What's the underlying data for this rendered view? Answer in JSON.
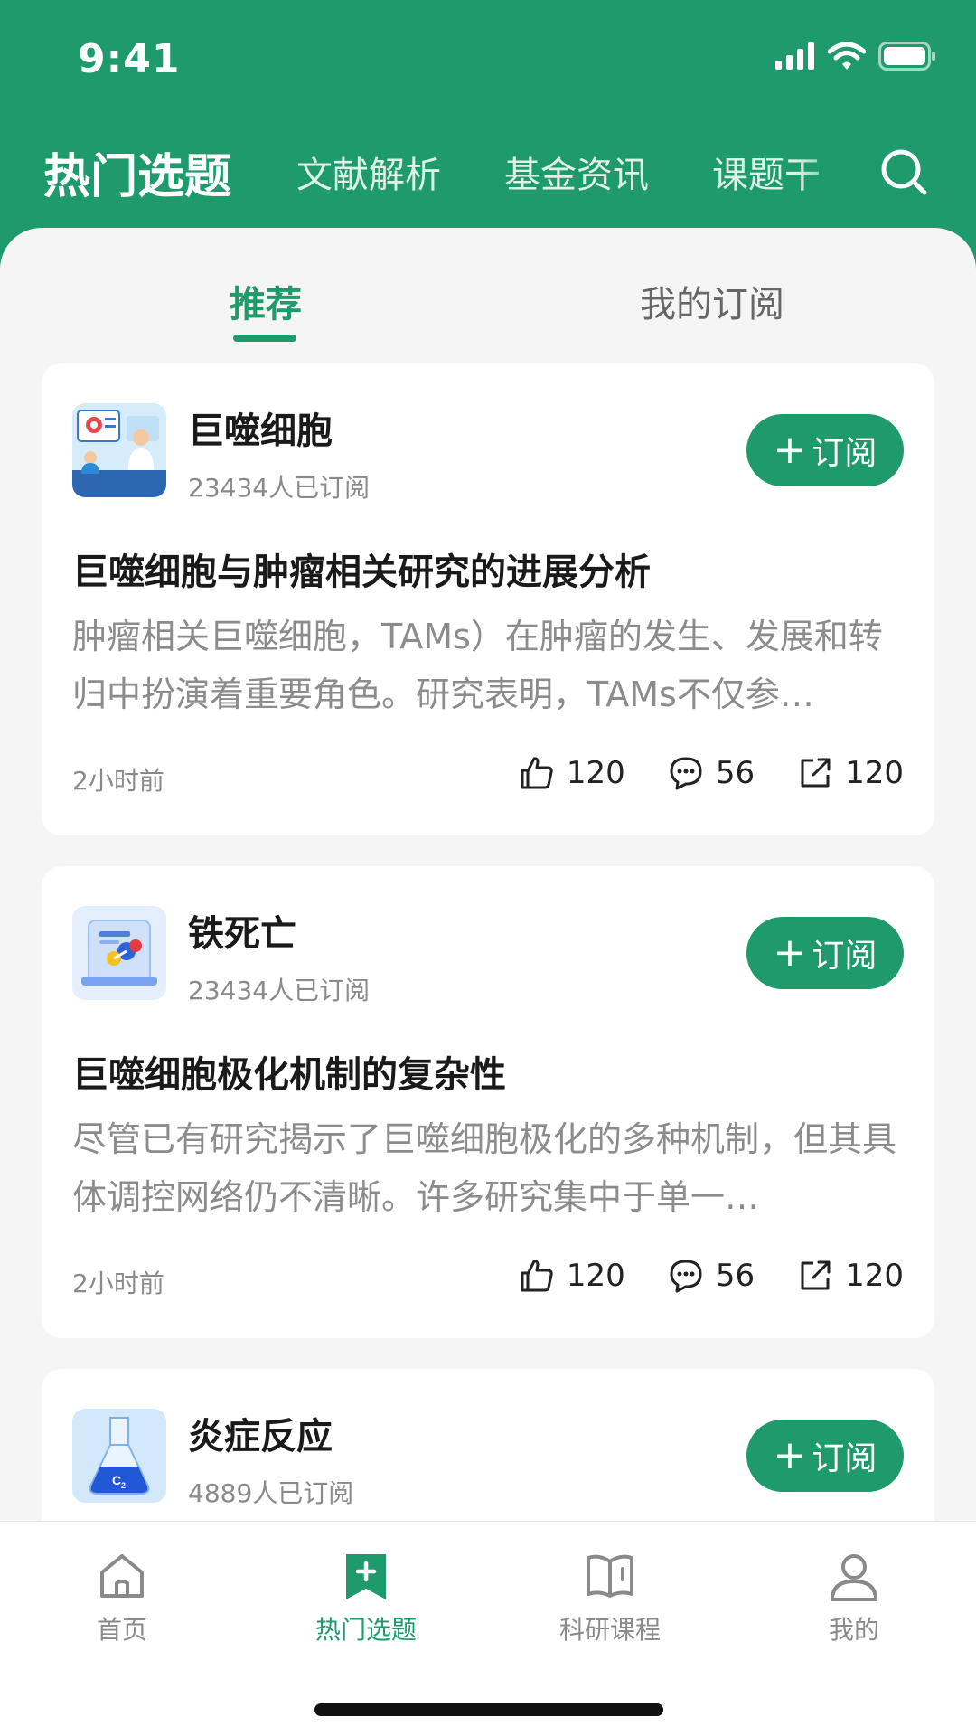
{
  "status_bar": {
    "time": "9:41"
  },
  "top_nav": {
    "tabs": [
      {
        "label": "热门选题",
        "active": true
      },
      {
        "label": "文献解析",
        "active": false
      },
      {
        "label": "基金资讯",
        "active": false
      },
      {
        "label": "课题干",
        "active": false
      }
    ]
  },
  "sub_tabs": {
    "recommend": "推荐",
    "my_subscriptions": "我的订阅"
  },
  "cards": [
    {
      "name": "巨噬细胞",
      "subscribers": "23434人已订阅",
      "subscribe_label": "订阅",
      "title": "巨噬细胞与肿瘤相关研究的进展分析",
      "excerpt": "肿瘤相关巨噬细胞，TAMs）在肿瘤的发生、发展和转归中扮演着重要角色。研究表明，TAMs不仅参…",
      "time": "2小时前",
      "likes": "120",
      "comments": "56",
      "shares": "120"
    },
    {
      "name": "铁死亡",
      "subscribers": "23434人已订阅",
      "subscribe_label": "订阅",
      "title": "巨噬细胞极化机制的复杂性",
      "excerpt": "尽管已有研究揭示了巨噬细胞极化的多种机制，但其具体调控网络仍不清晰。许多研究集中于单一…",
      "time": "2小时前",
      "likes": "120",
      "comments": "56",
      "shares": "120"
    },
    {
      "name": "炎症反应",
      "subscribers": "4889人已订阅",
      "subscribe_label": "订阅"
    }
  ],
  "bottom_nav": {
    "items": [
      {
        "label": "首页",
        "icon": "home-icon",
        "active": false
      },
      {
        "label": "热门选题",
        "icon": "bookmark-plus-icon",
        "active": true
      },
      {
        "label": "科研课程",
        "icon": "book-icon",
        "active": false
      },
      {
        "label": "我的",
        "icon": "user-icon",
        "active": false
      }
    ]
  },
  "colors": {
    "brand": "#1f9a6c",
    "background": "#f5f5f5"
  }
}
